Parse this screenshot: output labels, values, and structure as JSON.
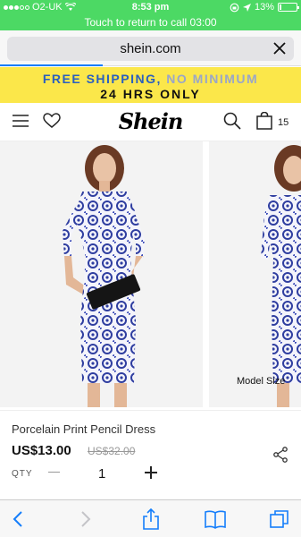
{
  "status_bar": {
    "carrier": "O2-UK",
    "time": "8:53 pm",
    "battery": "13%",
    "battery_level": 0.13,
    "call_banner": "Touch to return to call 03:00"
  },
  "browser": {
    "url": "shein.com",
    "load_progress": 0.34
  },
  "promo": {
    "line1_part1": "FREE SHIPPING,",
    "line1_part2": "NO MINIMUM",
    "line2": "24 HRS ONLY"
  },
  "header": {
    "logo": "Shein",
    "bag_count": "15"
  },
  "gallery": {
    "model_size_label": "Model Size"
  },
  "product": {
    "name": "Porcelain Print Pencil Dress",
    "price": "US$13.00",
    "original_price": "US$32.00",
    "qty_label": "QTY",
    "qty_value": "1"
  },
  "colors": {
    "status_green": "#4cd964",
    "promo_yellow": "#fbe74a",
    "promo_blue": "#2a5fbf",
    "ios_blue": "#157efb"
  },
  "icons": {
    "header": [
      "menu-icon",
      "heart-icon",
      "search-icon",
      "bag-icon"
    ],
    "toolbar": [
      "back-icon",
      "forward-icon",
      "share-icon",
      "bookmarks-icon",
      "tabs-icon"
    ]
  }
}
